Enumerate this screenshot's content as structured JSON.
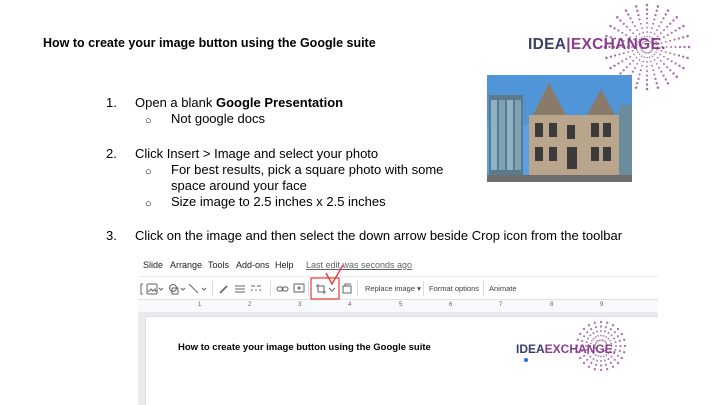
{
  "title": "How to create your image button using the Google suite",
  "logo": {
    "part1": "IDEA",
    "sep": "|",
    "part2": "EXCHANGE",
    "dot": "."
  },
  "steps": [
    {
      "num": "1.",
      "text_prefix": "Open a blank ",
      "text_bold": "Google Presentation",
      "subs": [
        "Not google docs"
      ]
    },
    {
      "num": "2.",
      "text": "Click Insert > Image and select your photo",
      "subs": [
        "For best results, pick a square photo with some",
        "space around your face",
        "Size image to 2.5 inches x 2.5 inches"
      ]
    },
    {
      "num": "3.",
      "text": "Click on the image and then select the down arrow beside Crop icon from the toolbar"
    }
  ],
  "bullet_glyph": "○",
  "screenshot": {
    "menu": [
      "Slide",
      "Arrange",
      "Tools",
      "Add-ons",
      "Help"
    ],
    "last_edit": "Last edit was seconds ago",
    "toolbar": {
      "replace_image": "Replace image ▾",
      "format_options": "Format options",
      "animate": "Animate"
    },
    "ruler": [
      "1",
      "2",
      "3",
      "4",
      "5",
      "6",
      "7",
      "8",
      "9"
    ],
    "slide_title": "How to create your image button using the Google suite",
    "logo": {
      "part1": "IDEA",
      "part2": "EXCHANGE",
      "dot": "."
    }
  },
  "colors": {
    "logo_navy": "#3a3d6e",
    "logo_purple": "#8a3d8f",
    "annotation_red": "#e53935"
  }
}
